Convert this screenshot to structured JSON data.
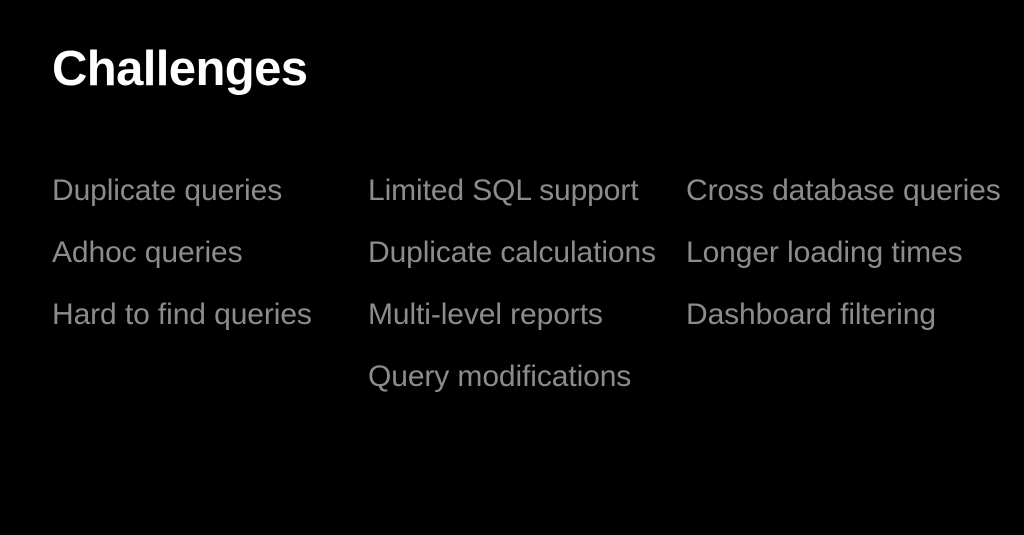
{
  "slide": {
    "background_color": "#000000",
    "title": "Challenges",
    "title_color": "#ffffff",
    "item_color": "#8c8c8c",
    "columns": [
      {
        "name": "column-1",
        "items": [
          "Duplicate queries",
          "Adhoc queries",
          "Hard to find queries"
        ]
      },
      {
        "name": "column-2",
        "items": [
          "Limited SQL support",
          "Duplicate calculations",
          "Multi-level reports",
          "Query modifications"
        ]
      },
      {
        "name": "column-3",
        "items": [
          "Cross database queries",
          "Longer loading times",
          "Dashboard filtering"
        ]
      }
    ]
  }
}
